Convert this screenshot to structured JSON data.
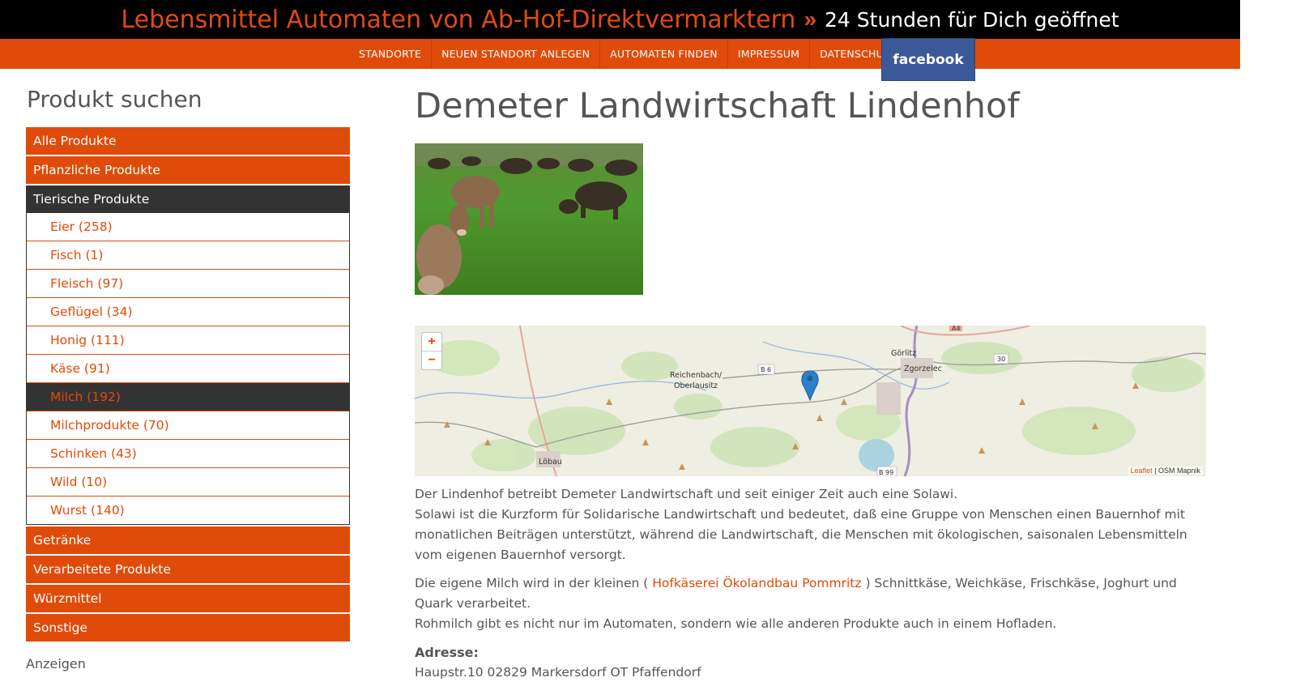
{
  "header": {
    "title": "Lebensmittel Automaten von Ab-Hof-Direktvermarktern",
    "separator": "»",
    "tagline": "24 Stunden für Dich geöffnet"
  },
  "nav": {
    "items": [
      "STANDORTE",
      "NEUEN STANDORT ANLEGEN",
      "AUTOMATEN FINDEN",
      "IMPRESSUM",
      "DATENSCHUTZ"
    ],
    "facebook": "facebook"
  },
  "sidebar": {
    "title": "Produkt suchen",
    "categories_top": [
      "Alle Produkte",
      "Pflanzliche Produkte"
    ],
    "active_category": "Tierische Produkte",
    "subcategories": [
      {
        "label": "Eier (258)"
      },
      {
        "label": "Fisch (1)"
      },
      {
        "label": "Fleisch (97)"
      },
      {
        "label": "Geflügel (34)"
      },
      {
        "label": "Honig (111)"
      },
      {
        "label": "Käse (91)"
      },
      {
        "label": "Milch (192)"
      },
      {
        "label": "Milchprodukte (70)"
      },
      {
        "label": "Schinken (43)"
      },
      {
        "label": "Wild (10)"
      },
      {
        "label": "Wurst (140)"
      }
    ],
    "active_subcategory": "Milch (192)",
    "categories_bottom": [
      "Getränke",
      "Verarbeitete Produkte",
      "Würzmittel",
      "Sonstige"
    ],
    "ads_label": "Anzeigen"
  },
  "main": {
    "title": "Demeter Landwirtschaft Lindenhof",
    "map": {
      "zoom_in": "+",
      "zoom_out": "−",
      "labels": [
        "Görlitz",
        "Zgorzelec",
        "Reichenbach/",
        "Oberlausitz",
        "Löbau",
        "B 6",
        "B 99",
        "30",
        "A4"
      ],
      "attribution_leaflet": "Leaflet",
      "attribution_rest": " | OSM Mapnik"
    },
    "desc_p1_line1": "Der Lindenhof betreibt Demeter Landwirtschaft und seit einiger Zeit auch eine Solawi.",
    "desc_p1_line2": "Solawi ist die Kurzform für Solidarische Landwirtschaft und bedeutet, daß eine Gruppe von Menschen einen Bauernhof mit monatlichen Beiträgen unterstützt, während die Landwirtschaft, die Menschen mit ökologischen, saisonalen Lebensmitteln vom eigenen Bauernhof versorgt.",
    "desc_p2_before": "Die eigene Milch wird in der kleinen ( ",
    "desc_p2_link": "Hofkäserei Ökolandbau Pommritz",
    "desc_p2_after": " ) Schnittkäse, Weichkäse, Frischkäse, Joghurt und Quark verarbeitet.",
    "desc_p2_line2": "Rohmilch gibt es nicht nur im Automaten, sondern wie alle anderen Produkte auch in einem Hofladen.",
    "address_label": "Adresse:",
    "address": "Haupstr.10  02829 Markersdorf OT Pfaffendorf"
  },
  "colors": {
    "accent": "#e04b09",
    "dark": "#333333",
    "facebook": "#3b5998"
  }
}
